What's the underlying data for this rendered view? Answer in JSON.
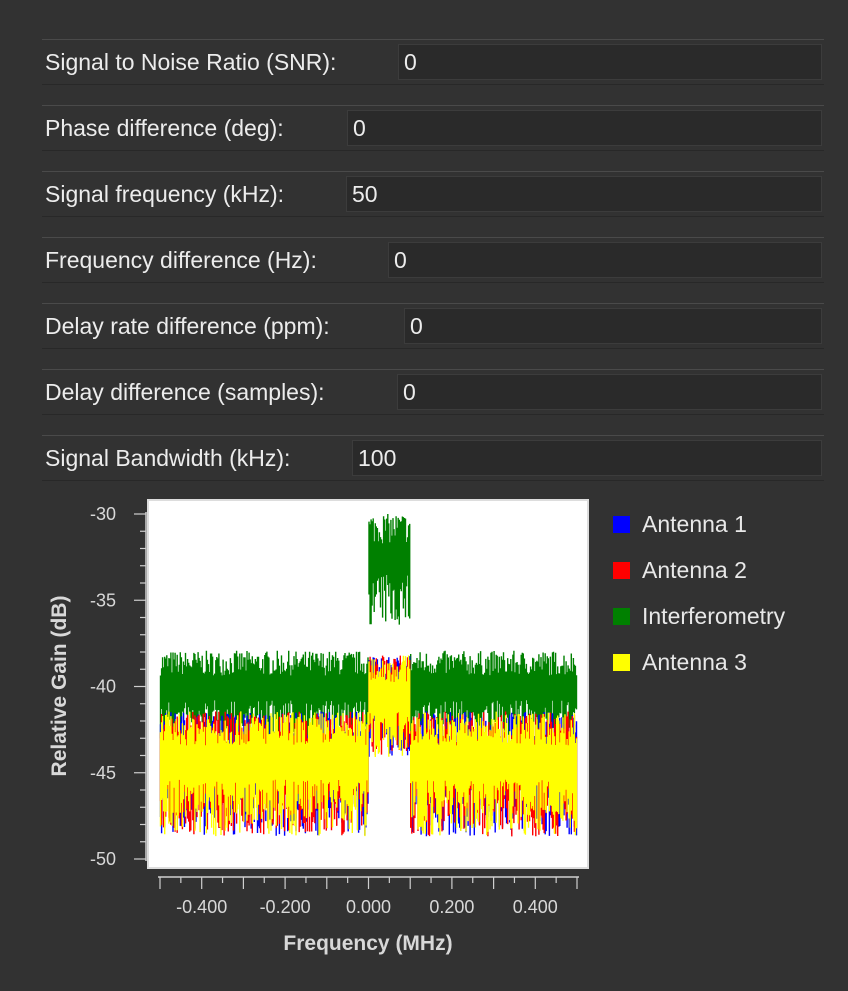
{
  "fields": [
    {
      "label": "Signal to Noise Ratio (SNR):",
      "value": "0"
    },
    {
      "label": "Phase difference (deg):",
      "value": "0"
    },
    {
      "label": "Signal frequency (kHz):",
      "value": "50"
    },
    {
      "label": "Frequency difference (Hz):",
      "value": "0"
    },
    {
      "label": "Delay rate difference (ppm):",
      "value": "0"
    },
    {
      "label": "Delay difference (samples):",
      "value": "0"
    },
    {
      "label": "Signal Bandwidth (kHz):",
      "value": "100"
    }
  ],
  "chart_data": {
    "type": "line",
    "xlabel": "Frequency (MHz)",
    "ylabel": "Relative Gain (dB)",
    "xlim": [
      -0.5,
      0.5
    ],
    "ylim": [
      -50,
      -30
    ],
    "x_ticks": [
      "-0.400",
      "-0.200",
      "0.000",
      "0.200",
      "0.400"
    ],
    "y_ticks": [
      "-30",
      "-35",
      "-40",
      "-45",
      "-50"
    ],
    "legend_position": "right",
    "grid": false,
    "series": [
      {
        "name": "Antenna 1",
        "color": "#0000ff",
        "noise_floor_db": -44.3,
        "peak_db": -40.5,
        "peak_band_mhz": [
          0.0,
          0.1
        ]
      },
      {
        "name": "Antenna 2",
        "color": "#ff0000",
        "noise_floor_db": -44.3,
        "peak_db": -40.5,
        "peak_band_mhz": [
          0.0,
          0.1
        ]
      },
      {
        "name": "Interferometry",
        "color": "#008000",
        "noise_floor_db": -40.0,
        "peak_db": -32.5,
        "peak_band_mhz": [
          0.0,
          0.1
        ]
      },
      {
        "name": "Antenna 3",
        "color": "#ffff00",
        "noise_floor_db": -44.3,
        "peak_db": -40.5,
        "peak_band_mhz": [
          0.0,
          0.1
        ]
      }
    ]
  }
}
